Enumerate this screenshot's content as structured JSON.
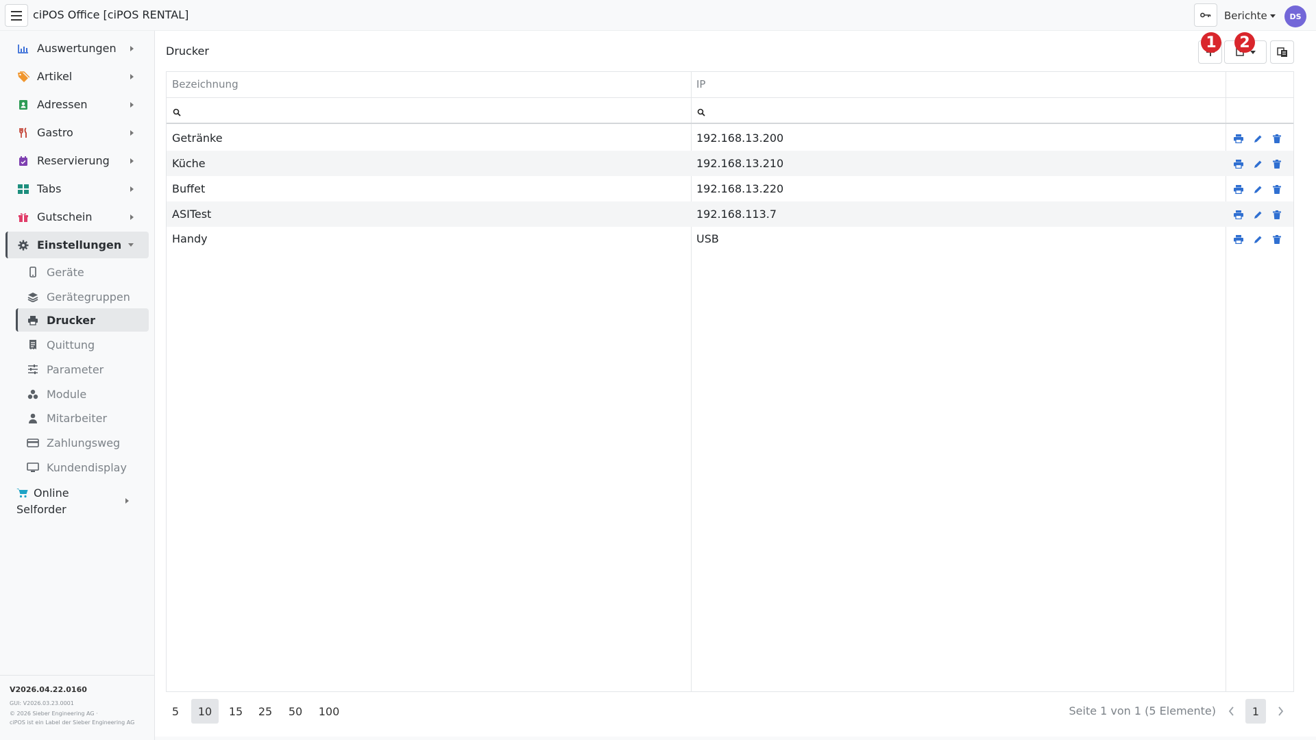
{
  "header": {
    "app_title": "ciPOS Office [ciPOS RENTAL]",
    "reports_label": "Berichte",
    "avatar_initials": "DS"
  },
  "sidebar": {
    "items": [
      {
        "label": "Auswertungen",
        "icon": "chart-icon",
        "color": "#3b6fd8"
      },
      {
        "label": "Artikel",
        "icon": "tag-icon",
        "color": "#f0962e"
      },
      {
        "label": "Adressen",
        "icon": "contact-icon",
        "color": "#2e9b55"
      },
      {
        "label": "Gastro",
        "icon": "cutlery-icon",
        "color": "#c0392b"
      },
      {
        "label": "Reservierung",
        "icon": "calendar-icon",
        "color": "#7e3fb0"
      },
      {
        "label": "Tabs",
        "icon": "grid-icon",
        "color": "#1e8f7e"
      },
      {
        "label": "Gutschein",
        "icon": "gift-icon",
        "color": "#e03e6a"
      },
      {
        "label": "Einstellungen",
        "icon": "gear-icon",
        "color": "#4a5057"
      }
    ],
    "sub_items": [
      {
        "label": "Geräte",
        "icon": "phone-icon"
      },
      {
        "label": "Gerätegruppen",
        "icon": "layers-icon"
      },
      {
        "label": "Drucker",
        "icon": "printer-icon"
      },
      {
        "label": "Quittung",
        "icon": "receipt-icon"
      },
      {
        "label": "Parameter",
        "icon": "sliders-icon"
      },
      {
        "label": "Module",
        "icon": "modules-icon"
      },
      {
        "label": "Mitarbeiter",
        "icon": "user-icon"
      },
      {
        "label": "Zahlungsweg",
        "icon": "card-icon"
      },
      {
        "label": "Kundendisplay",
        "icon": "monitor-icon"
      }
    ],
    "online_line1": "Online",
    "online_line2": "Selforder",
    "version": "V2026.04.22.0160",
    "gui_version": "GUI: V2026.03.23.0001",
    "copyright": "© 2026 Sieber Engineering AG ·",
    "label_note": "ciPOS ist ein Label der Sieber Engineering AG"
  },
  "main": {
    "page_title": "Drucker",
    "badge_1": "1",
    "badge_2": "2",
    "columns": [
      "Bezeichnung",
      "IP"
    ],
    "rows": [
      {
        "name": "Getränke",
        "ip": "192.168.13.200"
      },
      {
        "name": "Küche",
        "ip": "192.168.13.210"
      },
      {
        "name": "Buffet",
        "ip": "192.168.13.220"
      },
      {
        "name": "ASITest",
        "ip": "192.168.113.7"
      },
      {
        "name": "Handy",
        "ip": "USB"
      }
    ],
    "page_sizes": [
      "5",
      "10",
      "15",
      "25",
      "50",
      "100"
    ],
    "selected_page_size": "10",
    "page_info": "Seite 1 von 1 (5 Elemente)",
    "current_page": "1"
  },
  "colors": {
    "accent": "#3b7dd8",
    "badge": "#d9262c",
    "action_icon": "#2f6fd1"
  }
}
